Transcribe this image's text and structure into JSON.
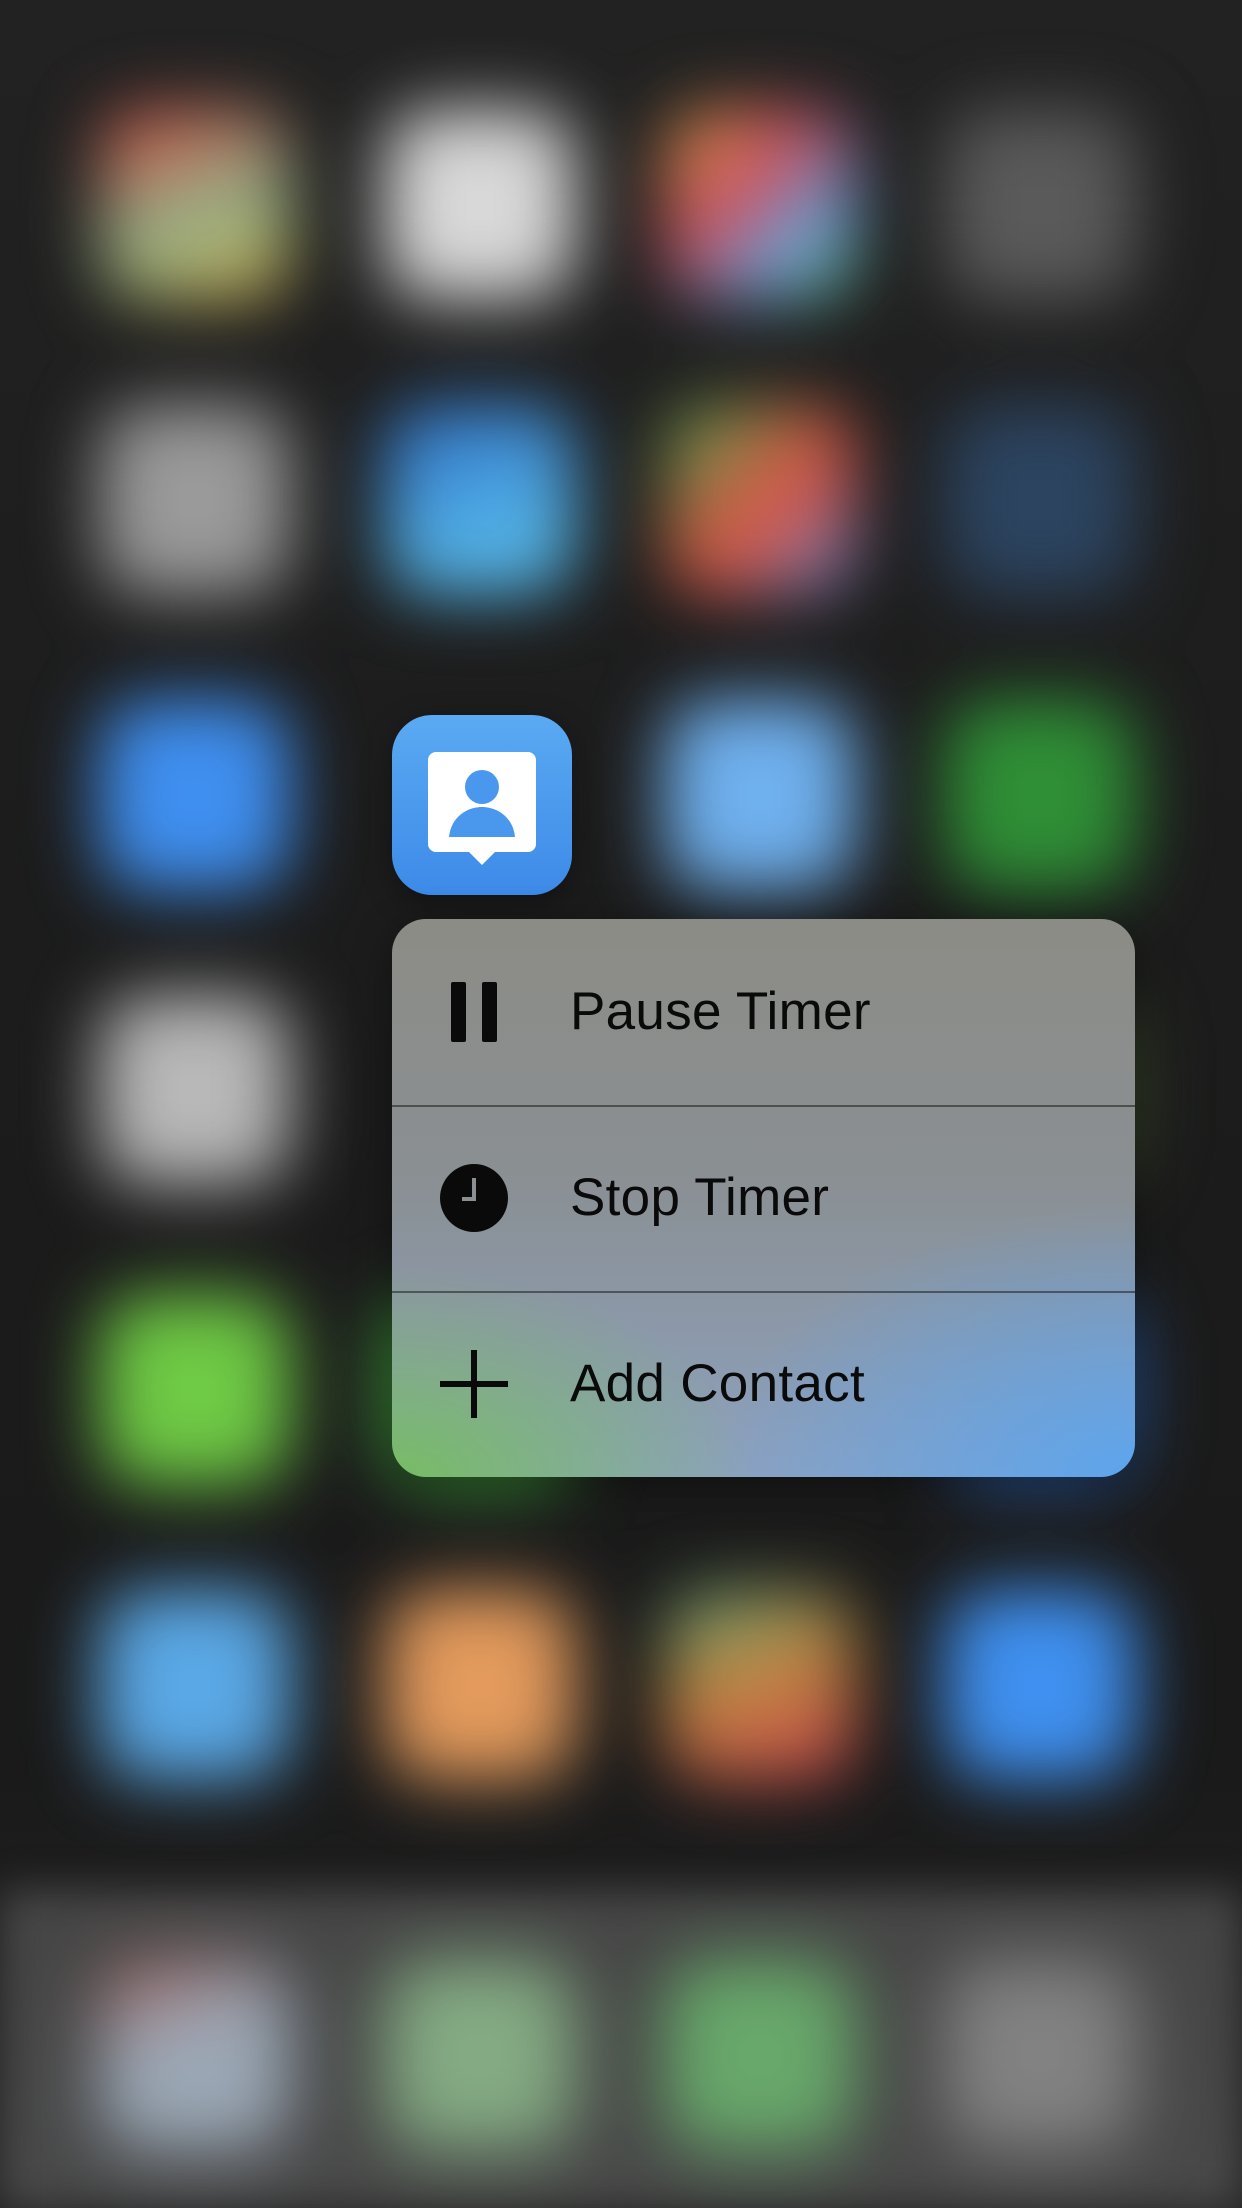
{
  "app": {
    "icon_name": "contact-timer-app-icon",
    "accent": "#4a98ee"
  },
  "quick_actions": [
    {
      "label": "Pause Timer",
      "icon": "pause-icon"
    },
    {
      "label": "Stop Timer",
      "icon": "clock-icon"
    },
    {
      "label": "Add Contact",
      "icon": "plus-icon"
    }
  ]
}
